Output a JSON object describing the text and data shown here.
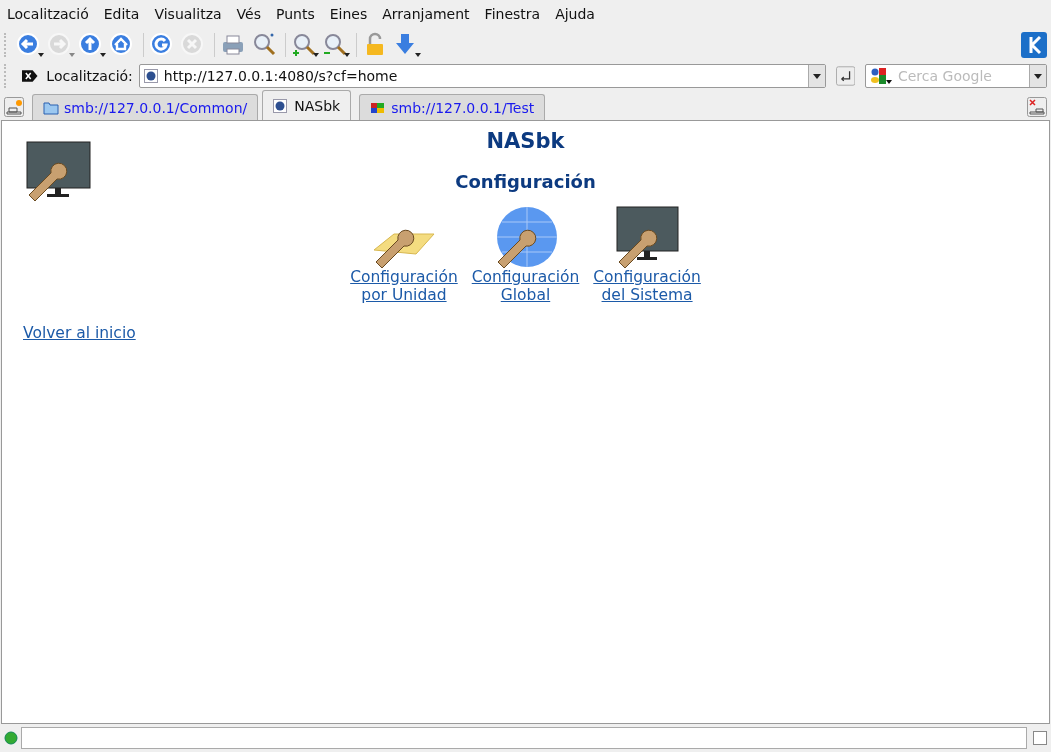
{
  "menu": [
    "Localització",
    "Edita",
    "Visualitza",
    "Vés",
    "Punts",
    "Eines",
    "Arranjament",
    "Finestra",
    "Ajuda"
  ],
  "toolbar": [
    {
      "kind": "back",
      "disabled": false,
      "dropdown": true
    },
    {
      "kind": "forward",
      "disabled": true,
      "dropdown": true
    },
    {
      "kind": "up",
      "disabled": false,
      "dropdown": true
    },
    {
      "kind": "home",
      "disabled": false,
      "dropdown": false
    },
    {
      "kind": "sep"
    },
    {
      "kind": "reload",
      "disabled": false,
      "dropdown": false
    },
    {
      "kind": "stop",
      "disabled": true,
      "dropdown": false
    },
    {
      "kind": "sep"
    },
    {
      "kind": "print",
      "disabled": false,
      "dropdown": false
    },
    {
      "kind": "find",
      "disabled": false,
      "dropdown": false
    },
    {
      "kind": "sep"
    },
    {
      "kind": "zoomin",
      "disabled": false,
      "dropdown": true
    },
    {
      "kind": "zoomout",
      "disabled": false,
      "dropdown": true
    },
    {
      "kind": "sep"
    },
    {
      "kind": "lock",
      "disabled": false,
      "dropdown": false
    },
    {
      "kind": "download",
      "disabled": false,
      "dropdown": true
    }
  ],
  "location": {
    "label": "Localització:",
    "url": "http://127.0.0.1:4080/s?cf=home"
  },
  "search": {
    "placeholder": "Cerca Google"
  },
  "status": {
    "checked": false
  },
  "tabs": [
    {
      "label": "smb://127.0.0.1/Common/",
      "kind": "folder",
      "selected": false
    },
    {
      "label": "NASbk",
      "kind": "web",
      "selected": true
    },
    {
      "label": "smb://127.0.0.1/Test",
      "kind": "share",
      "selected": false
    }
  ],
  "page": {
    "title": "NASbk",
    "subtitle": "Configuración",
    "items": [
      {
        "kind": "folders",
        "line1": "Configuración",
        "line2": "por Unidad"
      },
      {
        "kind": "globe",
        "line1": "Configuración",
        "line2": "Global"
      },
      {
        "kind": "monitor",
        "line1": "Configuración",
        "line2": "del Sistema"
      }
    ],
    "back_link": "Volver al inicio"
  }
}
